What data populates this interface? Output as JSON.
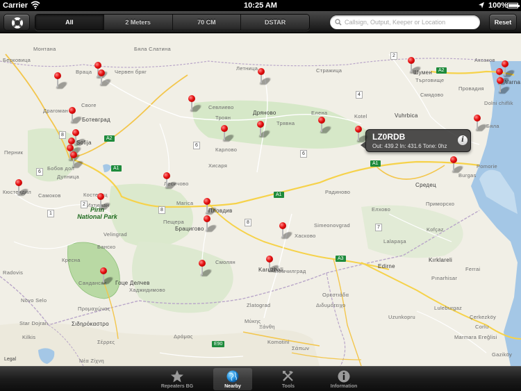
{
  "status_bar": {
    "carrier": "Carrier",
    "time": "10:25 AM",
    "battery": "100%",
    "battery_level": 1.0
  },
  "toolbar": {
    "lifebuoy_icon": "lifebuoy-icon",
    "segments": [
      {
        "label": "All",
        "active": true
      },
      {
        "label": "2 Meters",
        "active": false
      },
      {
        "label": "70 CM",
        "active": false
      },
      {
        "label": "DSTAR",
        "active": false
      }
    ],
    "search_placeholder": "Callsign, Output, Keeper or Location",
    "search_value": "",
    "reset_label": "Reset"
  },
  "map": {
    "park_label": "Pirin\nNational Park",
    "legal": "Legal",
    "labels": [
      "Монтана",
      "Бяла Слатина",
      "Летница",
      "Стражица",
      "Шумен",
      "Търговище",
      "Аксаков",
      "Varna",
      "Провадия",
      "Смядово",
      "Берковица",
      "Враца",
      "Червен бряг",
      "Своге",
      "Ботевград",
      "Драгоман",
      "Sofija",
      "Перник",
      "Бобов дол",
      "Дупница",
      "Кюстендил",
      "Самоков",
      "Костенец",
      "Ихтиман",
      "Лесичово",
      "Севлиево",
      "Дряново",
      "Троян",
      "Трявна",
      "Елена",
      "Kotel",
      "Vuhrbica",
      "Dolni chiflik",
      "Бяла",
      "Карлово",
      "Хисаря",
      "Pomorie",
      "Burgas",
      "Средец",
      "Радиново",
      "Елхово",
      "Приморско",
      "Marica",
      "Пловдив",
      "Пещера",
      "Брацигово",
      "Simeonovgrad",
      "Хасково",
      "Kofçaz",
      "Velingrad",
      "Банско",
      "Кресна",
      "Сандански",
      "Гоце Делчев",
      "Хаджидимово",
      "Смолян",
      "Kardzhali",
      "Момчилград",
      "Edirne",
      "Kırklareli",
      "Lalapaşa",
      "Pınarhisar",
      "Luleburgaz",
      "Uzunkopru",
      "Çerkezköy",
      "Corlu",
      "Marmara Ereğlisi",
      "Radovis",
      "Novo Selo",
      "Star Dojran",
      "Kilkis",
      "Σιδηρόκαστρο",
      "Προμαχώνας",
      "Σέρρες",
      "Νέα Ζίχνη",
      "Zlatograd",
      "Μύκης",
      "Ξάνθη",
      "Komotini",
      "Σάπων",
      "Δράμας",
      "Ορεστιάδα",
      "Διδυμότειχο",
      "Ferrai",
      "Gaziköy"
    ],
    "road_numbers": [
      "2",
      "4",
      "8",
      "6",
      "6",
      "6",
      "1",
      "8",
      "8",
      "7",
      "2"
    ],
    "highways": [
      "A2",
      "A1",
      "A1",
      "A1",
      "A3",
      "A2",
      "E90"
    ],
    "pin_count": 38
  },
  "callout": {
    "callsign": "LZ0RDB",
    "details": "Out: 439.2 In: 431.6 Tone: 0hz",
    "info_icon": "info-icon"
  },
  "tabbar": {
    "tabs": [
      {
        "label": "Repeaters BG",
        "icon": "star-icon",
        "active": false
      },
      {
        "label": "Nearby",
        "icon": "globe-icon",
        "active": true
      },
      {
        "label": "Tools",
        "icon": "tools-icon",
        "active": false
      },
      {
        "label": "Information",
        "icon": "info-icon",
        "active": false
      }
    ]
  }
}
